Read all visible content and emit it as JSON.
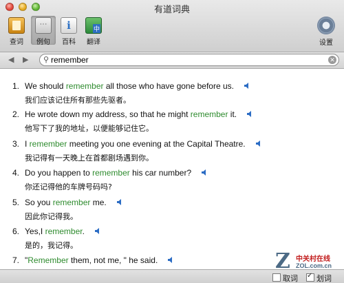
{
  "window": {
    "title": "有道词典"
  },
  "toolbar": {
    "items": [
      {
        "label": "查词",
        "icon": "dictionary-icon"
      },
      {
        "label": "例句",
        "icon": "sentence-bubble-icon"
      },
      {
        "label": "百科",
        "icon": "encyclopedia-icon"
      },
      {
        "label": "翻译",
        "icon": "translate-icon"
      }
    ],
    "settings_label": "设置"
  },
  "search": {
    "value": "remember",
    "back_icon": "◀",
    "forward_icon": "▶"
  },
  "highlight_color": "#2e8b2e",
  "sentences": [
    {
      "num": "1.",
      "pre": "We should ",
      "hl": "remember",
      "post": " all those who have gone before us.",
      "zh": "我们应该记住所有那些先驱者。"
    },
    {
      "num": "2.",
      "pre": "He wrote down my address, so that he might ",
      "hl": "remember",
      "post": " it.",
      "zh": "他写下了我的地址，以便能够记住它。"
    },
    {
      "num": "3.",
      "pre": "I ",
      "hl": "remember",
      "post": " meeting you one evening at the Capital Theatre.",
      "zh": "我记得有一天晚上在首都剧场遇到你。"
    },
    {
      "num": "4.",
      "pre": "Do you happen to ",
      "hl": "remember",
      "post": " his car number?",
      "zh": "你还记得他的车牌号码吗?"
    },
    {
      "num": "5.",
      "pre": "So you ",
      "hl": "remember",
      "post": " me.",
      "zh": "因此你记得我。"
    },
    {
      "num": "6.",
      "pre": "Yes,I ",
      "hl": "remember",
      "post": ".",
      "zh": "是的，我记得。"
    },
    {
      "num": "7.",
      "pre": "\"",
      "hl": "Remember",
      "post": " them, not me, \" he said.",
      "zh": ""
    }
  ],
  "bottom": {
    "option1": "取词",
    "option2": "划词"
  },
  "watermark": {
    "cn": "中关村在线",
    "url": "ZOL.com.cn"
  }
}
